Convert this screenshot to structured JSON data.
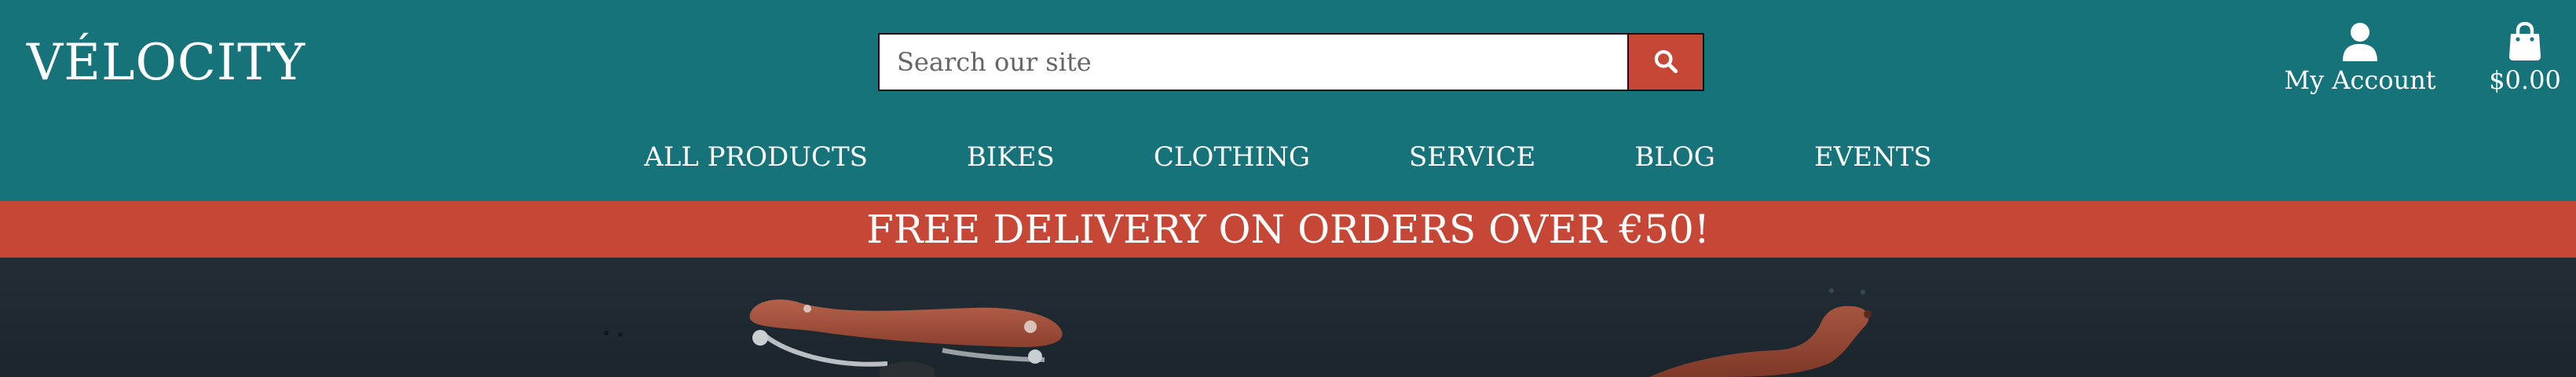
{
  "header": {
    "logo": "VÉLOCITY",
    "search": {
      "placeholder": "Search our site",
      "value": ""
    },
    "account_label": "My Account",
    "cart_total": "$0.00"
  },
  "nav": {
    "items": [
      {
        "label": "ALL PRODUCTS"
      },
      {
        "label": "BIKES"
      },
      {
        "label": "CLOTHING"
      },
      {
        "label": "SERVICE"
      },
      {
        "label": "BLOG"
      },
      {
        "label": "EVENTS"
      }
    ]
  },
  "promo": {
    "text": "FREE DELIVERY ON ORDERS OVER €50!"
  },
  "colors": {
    "header_bg": "#17737a",
    "accent": "#c74736",
    "hero_bg": "#1e2830",
    "saddle": "#a4533e"
  },
  "icons": [
    "search-icon",
    "user-icon",
    "shopping-bag-icon"
  ]
}
